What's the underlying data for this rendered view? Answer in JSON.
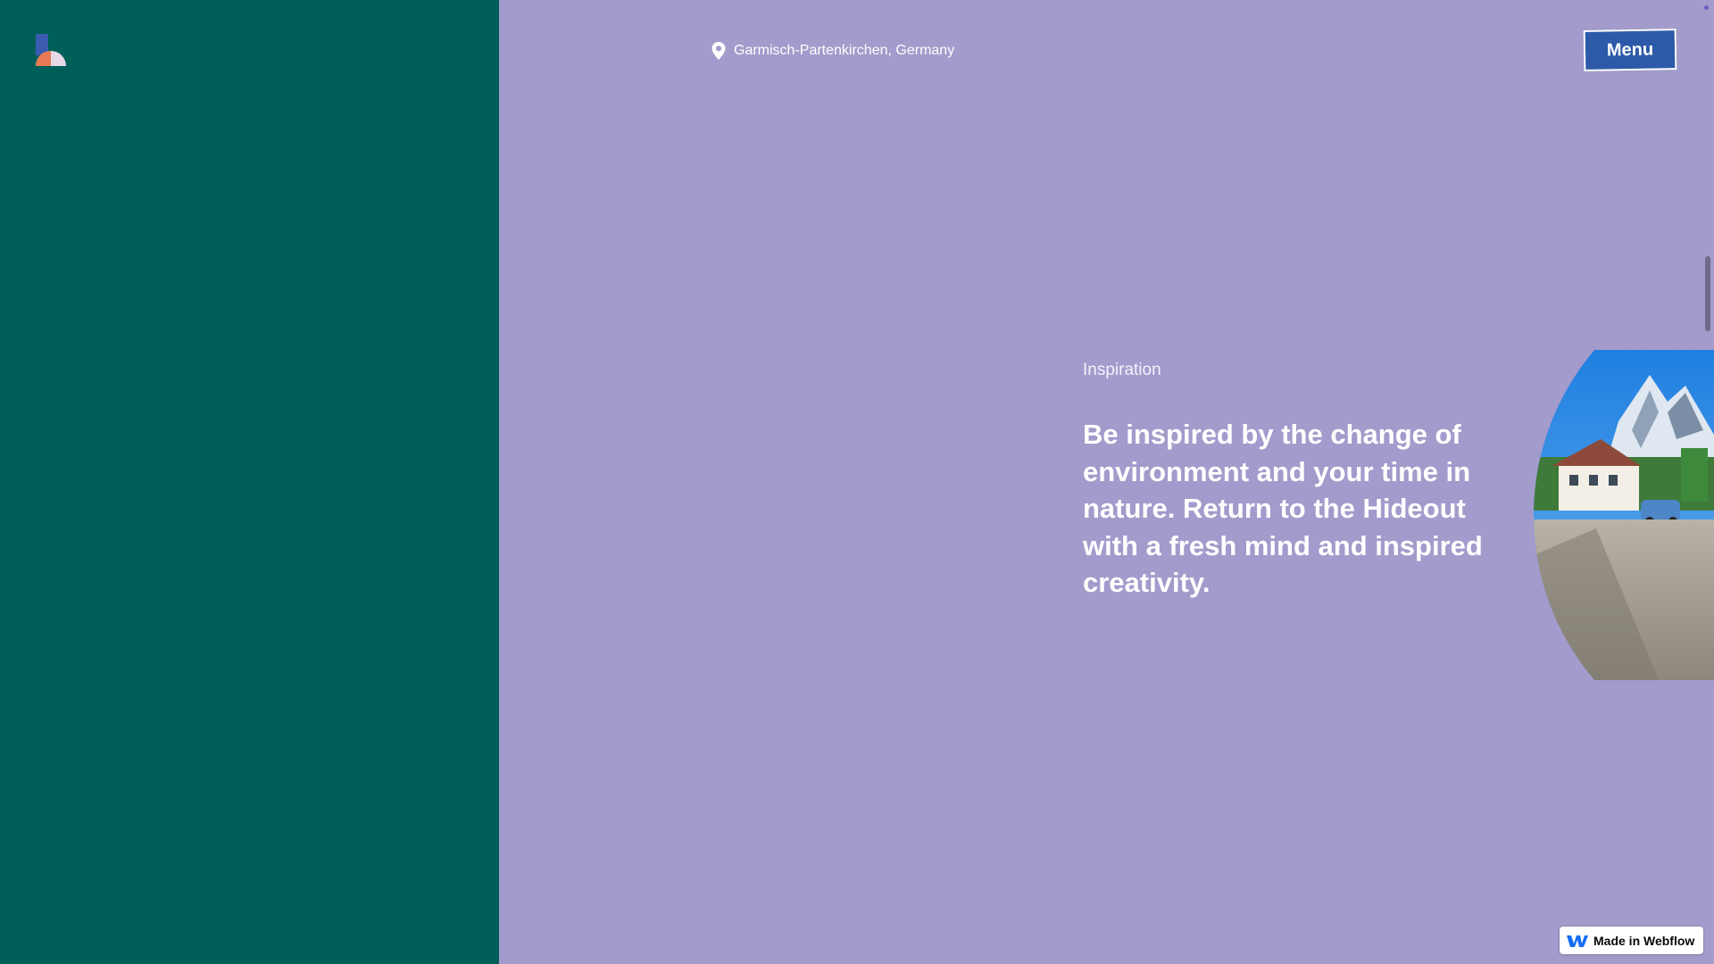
{
  "header": {
    "logo_icon": "hideout-logo-icon",
    "location_icon": "map-pin-icon",
    "location_text": "Garmisch-Partenkirchen, Germany",
    "menu_label": "Menu"
  },
  "section": {
    "label": "Inspiration",
    "headline": "Be inspired by the change of environment and your time in nature. Return to the Hideout with a fresh mind and inspired creativity.",
    "image_icon": "alpine-village-photo"
  },
  "badge": {
    "icon": "webflow-icon",
    "label": "Made in Webflow"
  },
  "colors": {
    "left_panel": "#005e59",
    "right_panel": "#a39bcb",
    "menu_button": "#2d5aa8",
    "text": "#ffffff"
  }
}
